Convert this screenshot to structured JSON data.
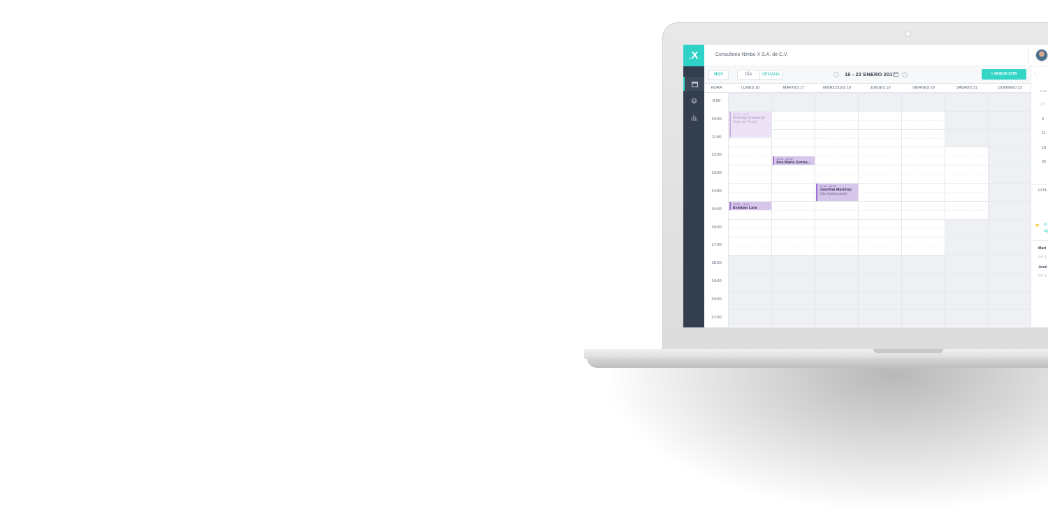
{
  "app": {
    "company_name": "Consultorio Nimbo X S.A. de C.V.",
    "logo_text": "X",
    "accent_color": "#35d6c8",
    "sidebar_color": "#333e4e"
  },
  "sidebar": {
    "items": [
      {
        "icon": "calendar-icon",
        "active": true
      },
      {
        "icon": "user-icon",
        "active": false
      },
      {
        "icon": "bar-chart-icon",
        "active": false
      }
    ]
  },
  "toolbar": {
    "today_label": "HOY",
    "view_day_label": "DÍA",
    "view_week_label": "SEMANA",
    "selected_view": "SEMANA",
    "date_range": "16 - 22 ENERO 2017",
    "new_appointment_label": "+ NUEVA CITA"
  },
  "calendar": {
    "hour_header": "HORA",
    "days": [
      "LUNES 16",
      "MARTES 17",
      "MIÉRCOLES 18",
      "JUEVES 19",
      "VIERNES 20",
      "SÁBADO 21",
      "DOMINGO 22"
    ],
    "hours": [
      "9:00",
      "10:00",
      "11:00",
      "12:00",
      "13:00",
      "14:00",
      "15:00",
      "16:00",
      "17:00",
      "18:00",
      "19:00",
      "20:00",
      "21:00"
    ],
    "events": [
      {
        "day": 0,
        "start": 10.0,
        "end": 11.5,
        "time": "10:00 - 11:30",
        "name": "Rodrigo Camargo",
        "note": "Dolor de Pecho",
        "faded": true
      },
      {
        "day": 1,
        "start": 12.5,
        "end": 13.0,
        "time": "12:00 - 12:30",
        "name": "Ana María Gonza...",
        "note": "",
        "faded": false
      },
      {
        "day": 2,
        "start": 14.0,
        "end": 15.0,
        "time": "14:30 - 15:30",
        "name": "Josefina Martínez",
        "note": "Cita Subsecuente",
        "faded": false
      },
      {
        "day": 0,
        "start": 15.0,
        "end": 15.5,
        "time": "15:30 - 16:00",
        "name": "Esteban Lara",
        "note": "",
        "faded": false
      }
    ]
  },
  "right_panel": {
    "weekday_header": "LUN",
    "week_numbers": [
      "28",
      "4",
      "11",
      "18",
      "25"
    ],
    "section_title": "CITA",
    "starred_lines": [
      "ni",
      "ag"
    ],
    "upcoming": [
      {
        "name": "Mari",
        "date": "Oct. 1"
      },
      {
        "name": "José",
        "date": "Oct. 1"
      }
    ]
  }
}
